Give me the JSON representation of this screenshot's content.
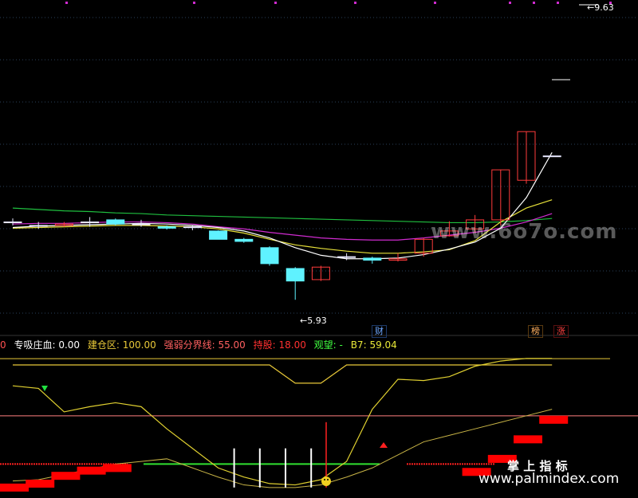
{
  "colors": {
    "bg": "#000000",
    "grid": "#2a3f5a",
    "up": "#ff3b3b",
    "down": "#5ff2ff",
    "flat": "#e8e8ff",
    "ma_white": "#ffffff",
    "ma_yellow": "#e8e23a",
    "ma_magenta": "#d02bd0",
    "ma_green": "#1fbf3f",
    "lower_yellow": "#e0d030",
    "lower_line": "#c8b446"
  },
  "price_labels": {
    "high": "9.63",
    "low": "5.93"
  },
  "tags": [
    {
      "text": "财",
      "color": "#6fa8ff"
    },
    {
      "text": "榜",
      "color": "#ffb060"
    },
    {
      "text": "涨",
      "color": "#ff4040"
    }
  ],
  "indicator_bar": {
    "prefix": "0",
    "items": [
      {
        "label": "专吸庄血:",
        "value": " 0.00",
        "color": "#ffffff"
      },
      {
        "label": "建仓区:",
        "value": " 100.00",
        "color": "#e8c838"
      },
      {
        "label": "强弱分界线:",
        "value": " 55.00",
        "color": "#ff6060"
      },
      {
        "label": "持股:",
        "value": " 18.00",
        "color": "#ff3030"
      },
      {
        "label": "观望:",
        "value": " -",
        "color": "#40ff40"
      },
      {
        "label": "B7:",
        "value": " 59.04",
        "color": "#e8e838"
      }
    ]
  },
  "watermarks": {
    "upper": "www.6o7o.com",
    "lower_cn": "掌 上 指 标",
    "lower_url": "www.palmindex.com"
  },
  "chart_data": {
    "type": "candlestick",
    "upper": {
      "ylim": [
        5.6,
        9.9
      ],
      "x_count": 22,
      "candles": [
        {
          "o": 7.05,
          "c": 7.05,
          "h": 7.1,
          "l": 7.0
        },
        {
          "o": 7.0,
          "c": 7.0,
          "h": 7.05,
          "l": 6.95
        },
        {
          "o": 7.0,
          "c": 7.02,
          "h": 7.05,
          "l": 6.98
        },
        {
          "o": 7.05,
          "c": 7.05,
          "h": 7.12,
          "l": 6.98
        },
        {
          "o": 7.08,
          "c": 7.02,
          "h": 7.1,
          "l": 7.0
        },
        {
          "o": 7.02,
          "c": 7.02,
          "h": 7.08,
          "l": 6.98
        },
        {
          "o": 6.98,
          "c": 6.96,
          "h": 7.0,
          "l": 6.94
        },
        {
          "o": 6.98,
          "c": 6.98,
          "h": 7.0,
          "l": 6.93
        },
        {
          "o": 6.92,
          "c": 6.8,
          "h": 6.93,
          "l": 6.8
        },
        {
          "o": 6.8,
          "c": 6.77,
          "h": 6.82,
          "l": 6.75
        },
        {
          "o": 6.68,
          "c": 6.45,
          "h": 6.7,
          "l": 6.42
        },
        {
          "o": 6.38,
          "c": 6.2,
          "h": 6.4,
          "l": 5.93
        },
        {
          "o": 6.22,
          "c": 6.4,
          "h": 6.42,
          "l": 6.2
        },
        {
          "o": 6.55,
          "c": 6.55,
          "h": 6.6,
          "l": 6.5
        },
        {
          "o": 6.53,
          "c": 6.5,
          "h": 6.55,
          "l": 6.45
        },
        {
          "o": 6.5,
          "c": 6.52,
          "h": 6.6,
          "l": 6.48
        },
        {
          "o": 6.6,
          "c": 6.8,
          "h": 6.82,
          "l": 6.55
        },
        {
          "o": 6.85,
          "c": 6.92,
          "h": 7.06,
          "l": 6.84
        },
        {
          "o": 6.95,
          "c": 7.08,
          "h": 7.15,
          "l": 6.9
        },
        {
          "o": 7.08,
          "c": 7.8,
          "h": 7.8,
          "l": 7.0
        },
        {
          "o": 7.65,
          "c": 8.35,
          "h": 8.35,
          "l": 7.6
        },
        {
          "o": 8.0,
          "c": 8.0,
          "h": 8.0,
          "l": 8.0
        }
      ],
      "ma_white": [
        6.97,
        6.99,
        7.0,
        7.01,
        7.02,
        7.03,
        7.02,
        7.0,
        6.97,
        6.92,
        6.82,
        6.68,
        6.57,
        6.52,
        6.52,
        6.53,
        6.58,
        6.66,
        6.76,
        6.96,
        7.4,
        8.05
      ],
      "ma_yellow": [
        6.96,
        6.97,
        6.98,
        6.99,
        7.0,
        7.0,
        6.99,
        6.98,
        6.95,
        6.89,
        6.8,
        6.72,
        6.67,
        6.63,
        6.6,
        6.6,
        6.62,
        6.65,
        6.78,
        7.05,
        7.25,
        7.37
      ],
      "ma_magenta": [
        7.02,
        7.03,
        7.03,
        7.04,
        7.05,
        7.05,
        7.04,
        7.02,
        6.98,
        6.95,
        6.9,
        6.86,
        6.82,
        6.8,
        6.79,
        6.79,
        6.82,
        6.86,
        6.9,
        6.96,
        7.05,
        7.17
      ],
      "ma_green": [
        7.25,
        7.23,
        7.21,
        7.2,
        7.18,
        7.17,
        7.15,
        7.14,
        7.13,
        7.12,
        7.11,
        7.1,
        7.09,
        7.08,
        7.07,
        7.06,
        7.05,
        7.04,
        7.04,
        7.05,
        7.07,
        7.1
      ]
    },
    "lower": {
      "ylim": [
        -5,
        105
      ],
      "jiancang": 100,
      "qiangruo": 55,
      "b7": [
        78,
        76,
        58,
        62,
        65,
        62,
        45,
        30,
        15,
        8,
        3,
        2,
        6,
        20,
        60,
        83,
        82,
        85,
        93,
        97,
        99,
        99
      ],
      "chixi_line": [
        5,
        6,
        10,
        14,
        18,
        20,
        22,
        15,
        8,
        2,
        0,
        0,
        2,
        8,
        15,
        25,
        35,
        40,
        45,
        50,
        55,
        60
      ],
      "band_yellow": [
        94,
        94,
        94,
        94,
        94,
        94,
        94,
        94,
        94,
        94,
        94,
        80,
        80,
        94,
        94,
        94,
        94,
        94,
        94,
        94,
        94,
        94
      ],
      "red_blocks": [
        3,
        6,
        12,
        16,
        18,
        0,
        0,
        0,
        0,
        0,
        0,
        0,
        0,
        0,
        0,
        0,
        0,
        0,
        15,
        25,
        40,
        55
      ],
      "white_bars": [
        0,
        0,
        0,
        0,
        0,
        0,
        0,
        0,
        18,
        18,
        18,
        18,
        0,
        0,
        0,
        0,
        0,
        0,
        0,
        0,
        0,
        0
      ],
      "green_level": 18
    }
  }
}
